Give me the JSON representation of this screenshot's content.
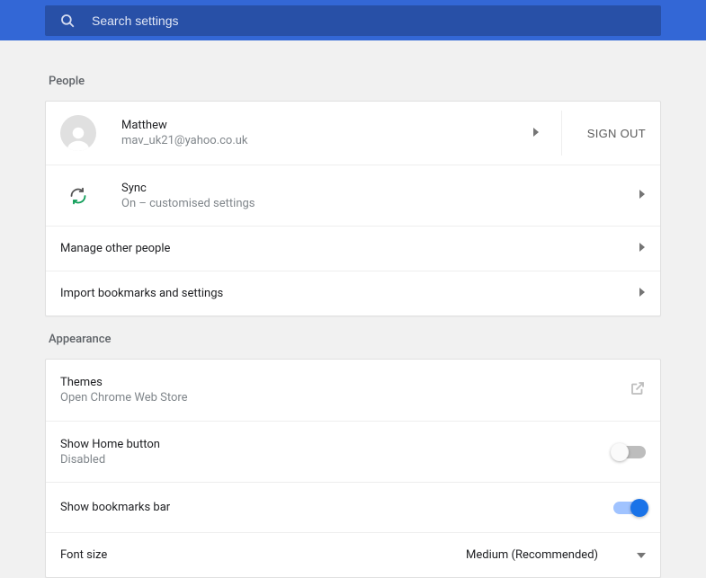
{
  "search": {
    "placeholder": "Search settings"
  },
  "sections": {
    "people": {
      "title": "People",
      "account": {
        "name": "Matthew",
        "email": "mav_uk21@yahoo.co.uk"
      },
      "sign_out": "SIGN OUT",
      "sync": {
        "title": "Sync",
        "status": "On – customised settings"
      },
      "manage": "Manage other people",
      "import": "Import bookmarks and settings"
    },
    "appearance": {
      "title": "Appearance",
      "themes": {
        "title": "Themes",
        "sub": "Open Chrome Web Store"
      },
      "home_button": {
        "title": "Show Home button",
        "status": "Disabled",
        "enabled": false
      },
      "bookmarks_bar": {
        "title": "Show bookmarks bar",
        "enabled": true
      },
      "font_size": {
        "title": "Font size",
        "value": "Medium (Recommended)"
      }
    }
  }
}
